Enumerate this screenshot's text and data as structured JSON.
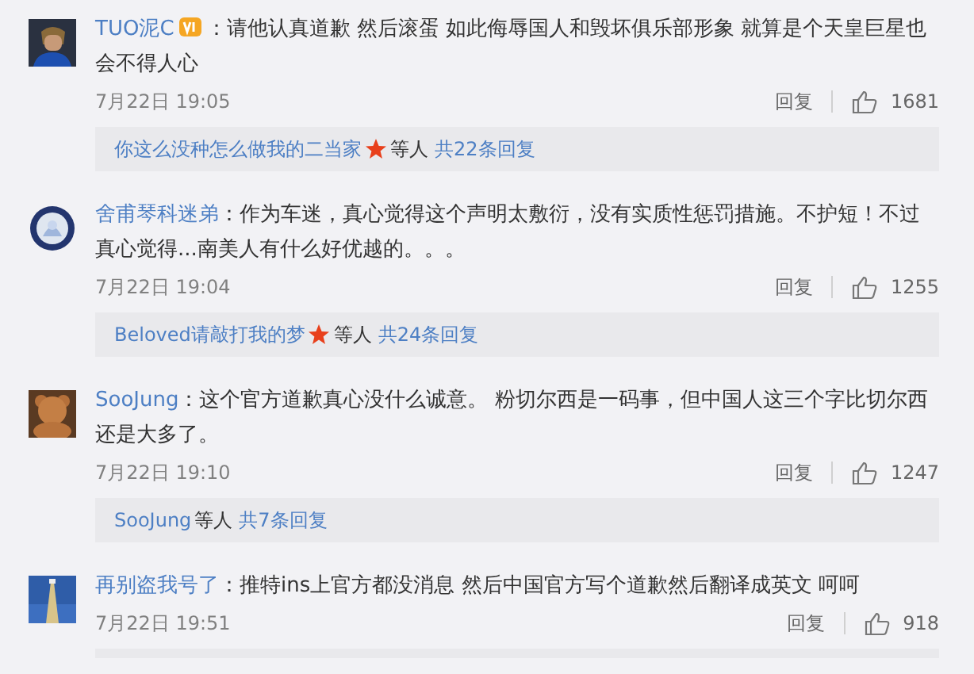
{
  "comments": [
    {
      "user": "TUO泥C",
      "vip_badge": true,
      "text": "：请他认真道歉 然后滚蛋 如此侮辱国人和毁坏俱乐部形象 就算是个天皇巨星也会不得人心",
      "time": "7月22日 19:05",
      "reply": "回复",
      "likes": "1681",
      "replies": {
        "users": "你这么没种怎么做我的二当家",
        "star": true,
        "suffix": "等人",
        "count": "共22条回复"
      }
    },
    {
      "user": "舍甫琴科迷弟",
      "vip_badge": false,
      "text": "：作为车迷，真心觉得这个声明太敷衍，没有实质性惩罚措施。不护短！不过真心觉得...南美人有什么好优越的。。。",
      "time": "7月22日 19:04",
      "reply": "回复",
      "likes": "1255",
      "replies": {
        "users": "Beloved请敲打我的梦",
        "star": true,
        "suffix": "等人",
        "count": "共24条回复"
      }
    },
    {
      "user": "SooJung",
      "vip_badge": false,
      "text": "：这个官方道歉真心没什么诚意。 粉切尔西是一码事，但中国人这三个字比切尔西还是大多了。",
      "time": "7月22日 19:10",
      "reply": "回复",
      "likes": "1247",
      "replies": {
        "users": "SooJung",
        "star": false,
        "suffix": "等人",
        "count": "共7条回复"
      }
    },
    {
      "user": "再别盗我号了",
      "vip_badge": false,
      "text": "：推特ins上官方都没消息 然后中国官方写个道歉然后翻译成英文 呵呵",
      "time": "7月22日 19:51",
      "reply": "回复",
      "likes": "918"
    }
  ]
}
